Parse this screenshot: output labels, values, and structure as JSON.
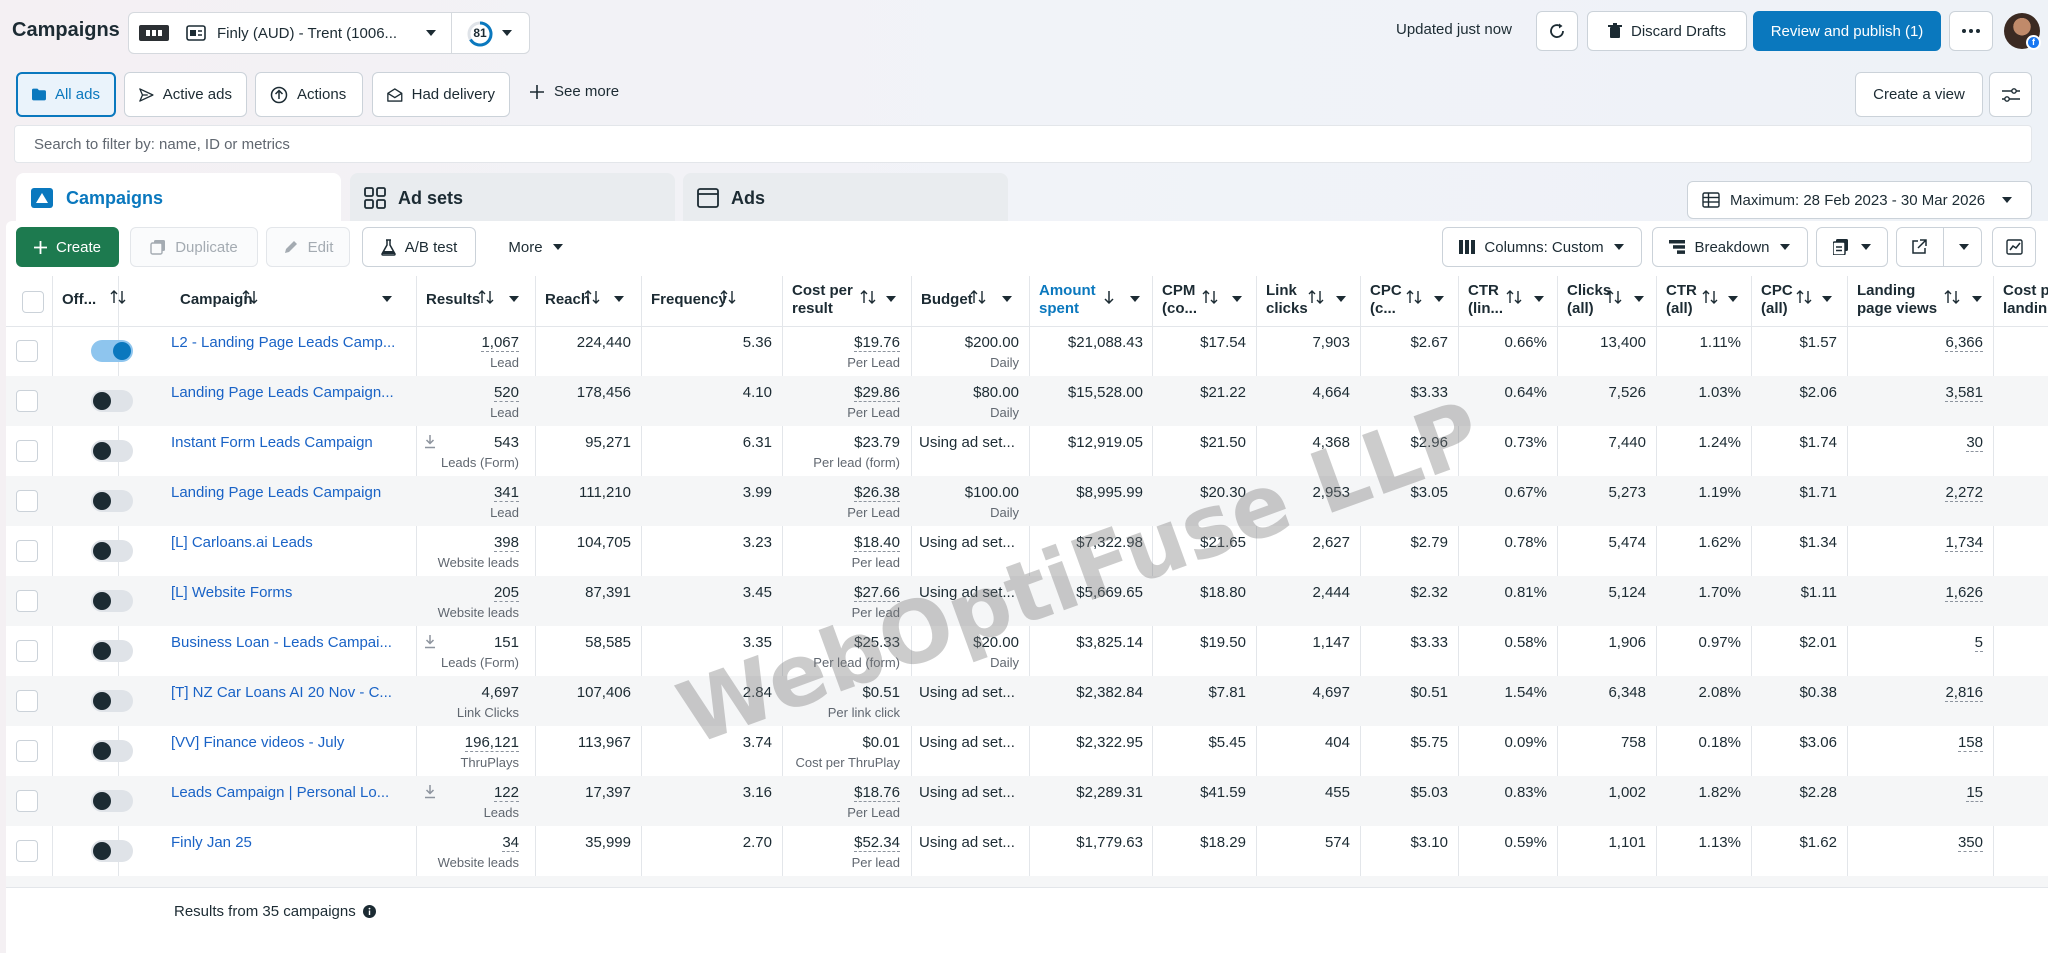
{
  "header": {
    "title": "Campaigns",
    "account_name": "Finly (AUD) - Trent (1006...",
    "score": "81",
    "updated": "Updated just now",
    "discard": "Discard Drafts",
    "publish": "Review and publish (1)"
  },
  "filters": {
    "chips": [
      "All ads",
      "Active ads",
      "Actions",
      "Had delivery"
    ],
    "see_more": "See more",
    "create_view": "Create a view"
  },
  "search": {
    "placeholder": "Search to filter by: name, ID or metrics"
  },
  "levels": {
    "campaigns": "Campaigns",
    "adsets": "Ad sets",
    "ads": "Ads"
  },
  "date_range": "Maximum: 28 Feb 2023 - 30 Mar 2026",
  "toolbar": {
    "create": "Create",
    "duplicate": "Duplicate",
    "edit": "Edit",
    "ab_test": "A/B test",
    "more": "More",
    "columns": "Columns: Custom",
    "breakdown": "Breakdown"
  },
  "columns": {
    "off": "Off...",
    "campaign": "Campaign",
    "results": "Results",
    "reach": "Reach",
    "frequency": "Frequency",
    "cost_per_result_1": "Cost per",
    "cost_per_result_2": "result",
    "budget": "Budget",
    "amount_spent_1": "Amount",
    "amount_spent_2": "spent",
    "cpm_1": "CPM",
    "cpm_2": "(co...",
    "link_clicks_1": "Link",
    "link_clicks_2": "clicks",
    "cpc_1": "CPC",
    "cpc_2": "(c...",
    "ctr_1": "CTR",
    "ctr_2": "(lin...",
    "clicks_all_1": "Clicks",
    "clicks_all_2": "(all)",
    "ctr_all_1": "CTR",
    "ctr_all_2": "(all)",
    "cpc_all_1": "CPC",
    "cpc_all_2": "(all)",
    "lpv_1": "Landing",
    "lpv_2": "page views",
    "cost_lpv_1": "Cost p",
    "cost_lpv_2": "landin"
  },
  "rows": [
    {
      "on": true,
      "name": "L2 - Landing Page Leads Camp...",
      "dl": false,
      "results": "1,067",
      "rtype": "Lead",
      "reach": "224,440",
      "freq": "5.36",
      "cpr": "$19.76",
      "cprt": "Per Lead",
      "budget": "$200.00",
      "btype": "Daily",
      "spent": "$21,088.43",
      "cpm": "$17.54",
      "lclicks": "7,903",
      "cpc": "$2.67",
      "ctr": "0.66%",
      "clicks": "13,400",
      "ctrall": "1.11%",
      "cpcall": "$1.57",
      "lpv": "6,366"
    },
    {
      "on": false,
      "name": "Landing Page Leads Campaign...",
      "dl": false,
      "results": "520",
      "rtype": "Lead",
      "reach": "178,456",
      "freq": "4.10",
      "cpr": "$29.86",
      "cprt": "Per Lead",
      "budget": "$80.00",
      "btype": "Daily",
      "spent": "$15,528.00",
      "cpm": "$21.22",
      "lclicks": "4,664",
      "cpc": "$3.33",
      "ctr": "0.64%",
      "clicks": "7,526",
      "ctrall": "1.03%",
      "cpcall": "$2.06",
      "lpv": "3,581"
    },
    {
      "on": false,
      "name": "Instant Form Leads Campaign",
      "dl": true,
      "results": "543",
      "rtype": "Leads (Form)",
      "reach": "95,271",
      "freq": "6.31",
      "cpr": "$23.79",
      "cprt": "Per lead (form)",
      "budget": "Using ad set...",
      "btype": "",
      "spent": "$12,919.05",
      "cpm": "$21.50",
      "lclicks": "4,368",
      "cpc": "$2.96",
      "ctr": "0.73%",
      "clicks": "7,440",
      "ctrall": "1.24%",
      "cpcall": "$1.74",
      "lpv": "30"
    },
    {
      "on": false,
      "name": "Landing Page Leads Campaign",
      "dl": false,
      "results": "341",
      "rtype": "Lead",
      "reach": "111,210",
      "freq": "3.99",
      "cpr": "$26.38",
      "cprt": "Per Lead",
      "budget": "$100.00",
      "btype": "Daily",
      "spent": "$8,995.99",
      "cpm": "$20.30",
      "lclicks": "2,953",
      "cpc": "$3.05",
      "ctr": "0.67%",
      "clicks": "5,273",
      "ctrall": "1.19%",
      "cpcall": "$1.71",
      "lpv": "2,272"
    },
    {
      "on": false,
      "name": "[L] Carloans.ai Leads",
      "dl": false,
      "results": "398",
      "rtype": "Website leads",
      "reach": "104,705",
      "freq": "3.23",
      "cpr": "$18.40",
      "cprt": "Per lead",
      "budget": "Using ad set...",
      "btype": "",
      "spent": "$7,322.98",
      "cpm": "$21.65",
      "lclicks": "2,627",
      "cpc": "$2.79",
      "ctr": "0.78%",
      "clicks": "5,474",
      "ctrall": "1.62%",
      "cpcall": "$1.34",
      "lpv": "1,734"
    },
    {
      "on": false,
      "name": "[L] Website Forms",
      "dl": false,
      "results": "205",
      "rtype": "Website leads",
      "reach": "87,391",
      "freq": "3.45",
      "cpr": "$27.66",
      "cprt": "Per lead",
      "budget": "Using ad set...",
      "btype": "",
      "spent": "$5,669.65",
      "cpm": "$18.80",
      "lclicks": "2,444",
      "cpc": "$2.32",
      "ctr": "0.81%",
      "clicks": "5,124",
      "ctrall": "1.70%",
      "cpcall": "$1.11",
      "lpv": "1,626"
    },
    {
      "on": false,
      "name": "Business Loan - Leads Campai...",
      "dl": true,
      "results": "151",
      "rtype": "Leads (Form)",
      "reach": "58,585",
      "freq": "3.35",
      "cpr": "$25.33",
      "cprt": "Per lead (form)",
      "budget": "$20.00",
      "btype": "Daily",
      "spent": "$3,825.14",
      "cpm": "$19.50",
      "lclicks": "1,147",
      "cpc": "$3.33",
      "ctr": "0.58%",
      "clicks": "1,906",
      "ctrall": "0.97%",
      "cpcall": "$2.01",
      "lpv": "5"
    },
    {
      "on": false,
      "name": "[T] NZ Car Loans AI 20 Nov - C...",
      "dl": false,
      "results": "4,697",
      "rtype": "Link Clicks",
      "reach": "107,406",
      "freq": "2.84",
      "cpr": "$0.51",
      "cprt": "Per link click",
      "budget": "Using ad set...",
      "btype": "",
      "spent": "$2,382.84",
      "cpm": "$7.81",
      "lclicks": "4,697",
      "cpc": "$0.51",
      "ctr": "1.54%",
      "clicks": "6,348",
      "ctrall": "2.08%",
      "cpcall": "$0.38",
      "lpv": "2,816"
    },
    {
      "on": false,
      "name": "[VV] Finance videos - July",
      "dl": false,
      "results": "196,121",
      "rtype": "ThruPlays",
      "reach": "113,967",
      "freq": "3.74",
      "cpr": "$0.01",
      "cprt": "Cost per ThruPlay",
      "budget": "Using ad set...",
      "btype": "",
      "spent": "$2,322.95",
      "cpm": "$5.45",
      "lclicks": "404",
      "cpc": "$5.75",
      "ctr": "0.09%",
      "clicks": "758",
      "ctrall": "0.18%",
      "cpcall": "$3.06",
      "lpv": "158"
    },
    {
      "on": false,
      "name": "Leads Campaign | Personal Lo...",
      "dl": true,
      "results": "122",
      "rtype": "Leads",
      "reach": "17,397",
      "freq": "3.16",
      "cpr": "$18.76",
      "cprt": "Per Lead",
      "budget": "Using ad set...",
      "btype": "",
      "spent": "$2,289.31",
      "cpm": "$41.59",
      "lclicks": "455",
      "cpc": "$5.03",
      "ctr": "0.83%",
      "clicks": "1,002",
      "ctrall": "1.82%",
      "cpcall": "$2.28",
      "lpv": "15"
    },
    {
      "on": false,
      "name": "Finly Jan 25",
      "dl": false,
      "results": "34",
      "rtype": "Website leads",
      "reach": "35,999",
      "freq": "2.70",
      "cpr": "$52.34",
      "cprt": "Per lead",
      "budget": "Using ad set...",
      "btype": "",
      "spent": "$1,779.63",
      "cpm": "$18.29",
      "lclicks": "574",
      "cpc": "$3.10",
      "ctr": "0.59%",
      "clicks": "1,101",
      "ctrall": "1.13%",
      "cpcall": "$1.62",
      "lpv": "350"
    }
  ],
  "footer": {
    "results_text": "Results from 35 campaigns"
  },
  "watermark": "WebOptiFuse LLP",
  "colors": {
    "accent": "#0a78be",
    "create": "#1d7a4f",
    "link": "#1a63c6"
  }
}
